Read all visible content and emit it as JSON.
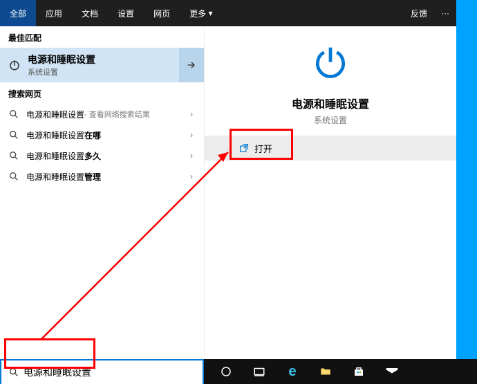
{
  "nav": {
    "tabs": [
      "全部",
      "应用",
      "文档",
      "设置",
      "网页",
      "更多"
    ],
    "active_index": 0,
    "feedback": "反馈"
  },
  "sections": {
    "best_match": "最佳匹配",
    "search_web": "搜索网页"
  },
  "best_match": {
    "title": "电源和睡眠设置",
    "subtitle": "系统设置"
  },
  "web_results": [
    {
      "text": "电源和睡眠设置",
      "suffix": " - 查看网络搜索结果",
      "bold": ""
    },
    {
      "text": "电源和睡眠设置 ",
      "suffix": "",
      "bold": "在哪"
    },
    {
      "text": "电源和睡眠设置",
      "suffix": "",
      "bold": "多久"
    },
    {
      "text": "电源和睡眠设置",
      "suffix": "",
      "bold": "管理"
    }
  ],
  "detail": {
    "title": "电源和睡眠设置",
    "subtitle": "系统设置",
    "open": "打开"
  },
  "search": {
    "value": "电源和睡眠设置"
  }
}
